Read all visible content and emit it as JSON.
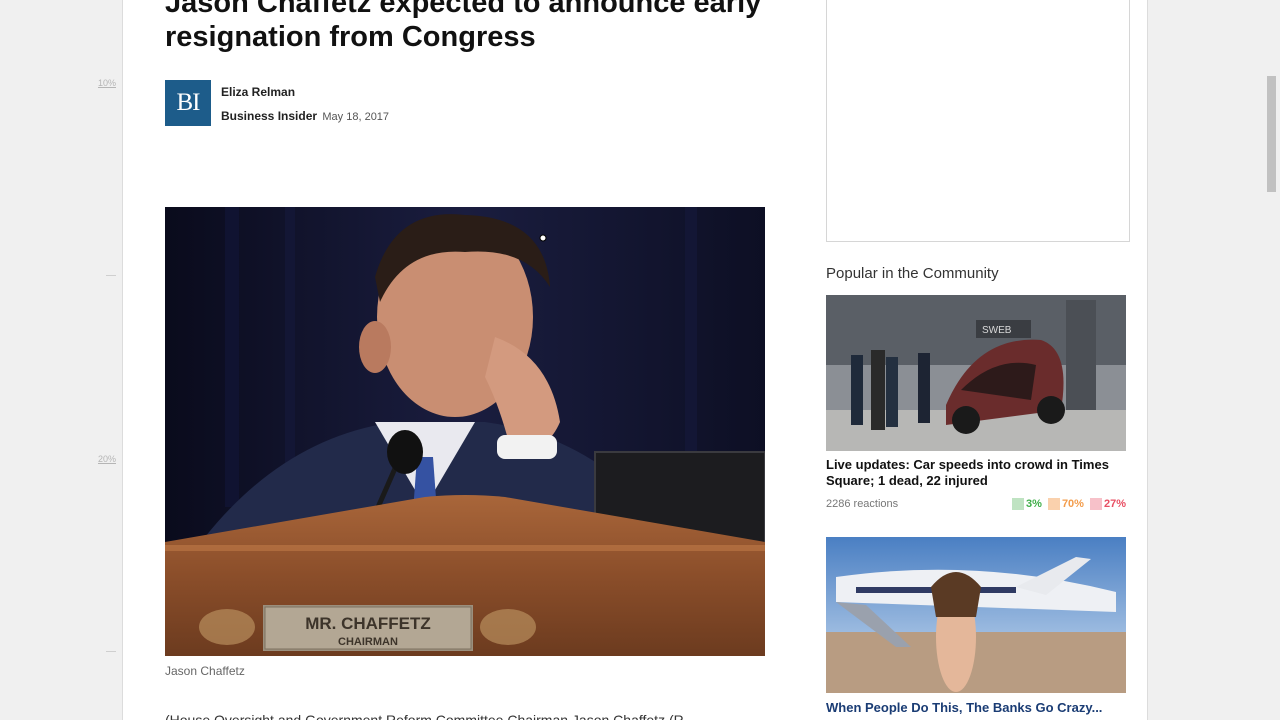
{
  "article": {
    "headline": "Jason Chaffetz expected to announce early resignation from Congress",
    "author": "Eliza Relman",
    "publisher": "Business Insider",
    "date": "May 18, 2017",
    "logo_text": "BI",
    "hero_nameplate_line1": "MR. CHAFFETZ",
    "hero_nameplate_line2": "CHAIRMAN",
    "caption": "Jason Chaffetz",
    "body_start": "(House Oversight and Government Reform Committee Chairman Jason Chaffetz (R-"
  },
  "gutter": {
    "marker1": "10%",
    "marker2": "20%"
  },
  "sidebar": {
    "popular_title": "Popular in the Community",
    "card1": {
      "title": "Live updates: Car speeds into crowd in Times Square; 1 dead, 22 injured",
      "reactions": "2286 reactions",
      "stat1": "3%",
      "stat2": "70%",
      "stat3": "27%",
      "stat1_color": "#3fae49",
      "stat2_color": "#f39c4b",
      "stat3_color": "#e84f63"
    },
    "card2": {
      "title": "When People Do This, The Banks Go Crazy..."
    }
  }
}
